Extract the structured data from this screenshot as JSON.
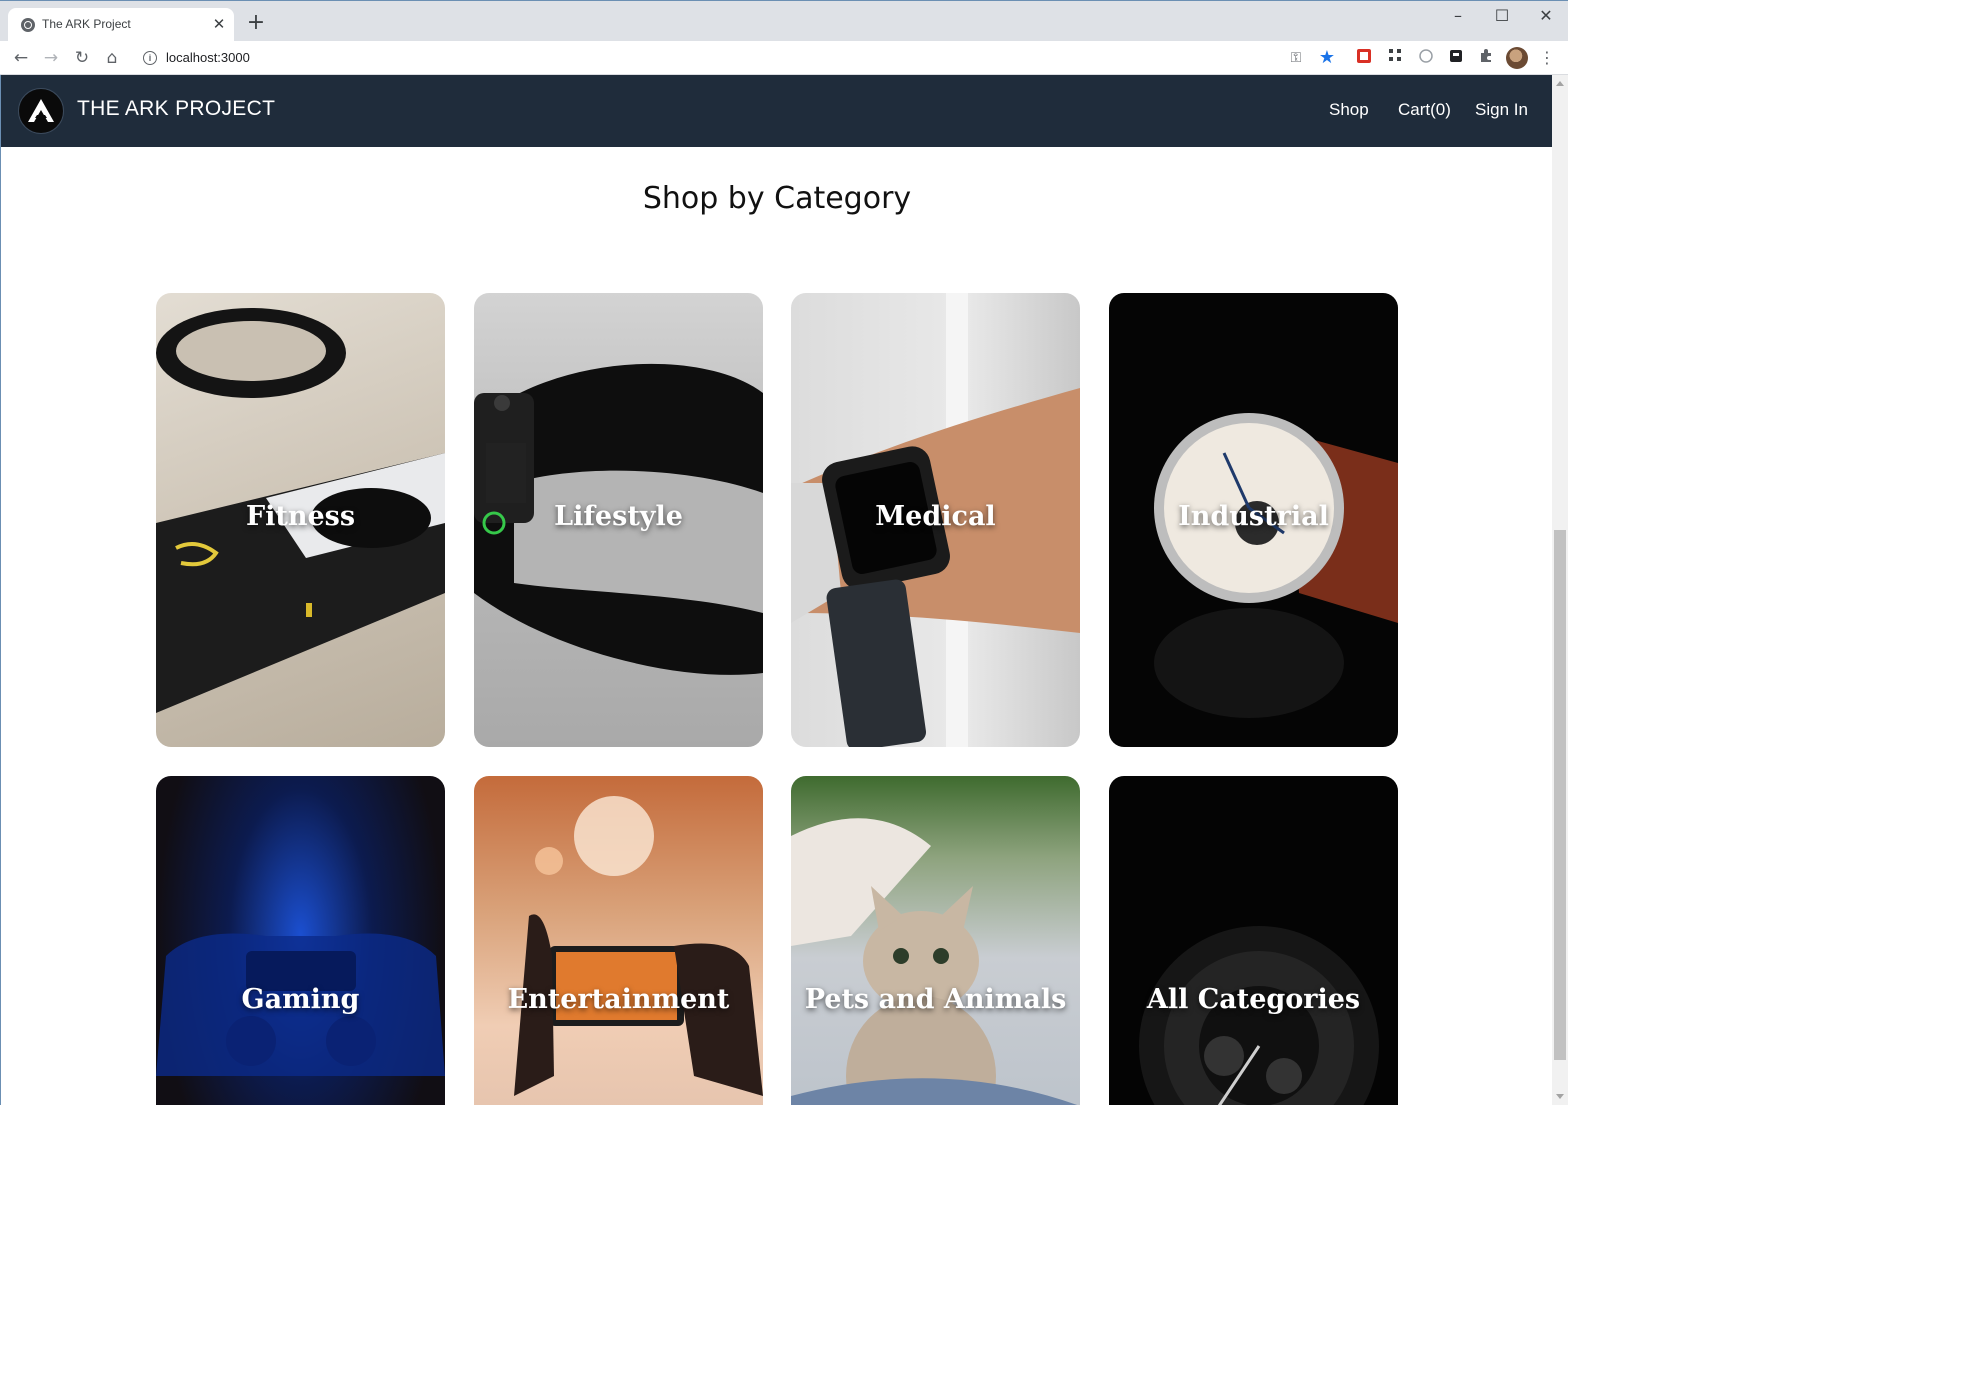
{
  "browser": {
    "tab_title": "The ARK Project",
    "url": "localhost:3000"
  },
  "site": {
    "brand": "THE ARK PROJECT",
    "nav": {
      "shop": "Shop",
      "cart": "Cart(0)",
      "sign_in": "Sign In"
    }
  },
  "section_title": "Shop by Category",
  "categories": [
    {
      "label": "Fitness"
    },
    {
      "label": "Lifestyle"
    },
    {
      "label": "Medical"
    },
    {
      "label": "Industrial"
    },
    {
      "label": "Gaming"
    },
    {
      "label": "Entertainment"
    },
    {
      "label": "Pets and Animals"
    },
    {
      "label": "All Categories"
    }
  ],
  "colors": {
    "navbar": "#1f2c3b",
    "tabstrip": "#dee1e6",
    "bookmark_star": "#1a73e8"
  }
}
